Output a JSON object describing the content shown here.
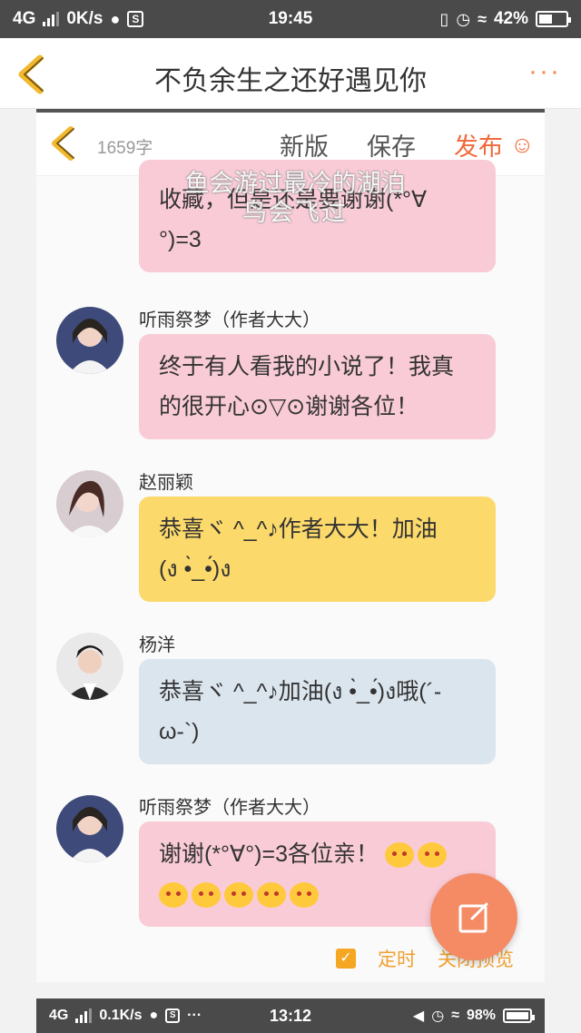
{
  "status_bar": {
    "network": "4G",
    "speed": "0K/s",
    "time": "19:45",
    "battery": "42%"
  },
  "header": {
    "title": "不负余生之还好遇见你"
  },
  "editor": {
    "word_count": "1659字",
    "new_version": "新版",
    "save": "保存",
    "publish": "发布",
    "publish_glyph": "◡̈"
  },
  "overlay": {
    "line1": "鱼会游过最冷的湖泊",
    "line2": "鸟会飞过"
  },
  "messages": [
    {
      "name": "",
      "lines": [
        "收藏，但是还是要谢谢(*°∀",
        "°)=3"
      ]
    },
    {
      "name": "听雨祭梦（作者大大）",
      "lines": [
        "终于有人看我的小说了！我真",
        "的很开心⊙▽⊙谢谢各位！"
      ]
    },
    {
      "name": "赵丽颖",
      "lines": [
        "恭喜ヾ ^_^♪作者大大！加油",
        "(ง •̀_•́)ง"
      ]
    },
    {
      "name": "杨洋",
      "lines": [
        "恭喜ヾ ^_^♪加油(ง •̀_•́)ง哦(´-",
        "ω-`)"
      ]
    },
    {
      "name": "听雨祭梦（作者大大）",
      "lines": [
        "谢谢(*°∀°)=3各位亲！"
      ]
    }
  ],
  "options": {
    "timed": "定时",
    "preview": "关闭预览"
  },
  "status_bar2": {
    "network": "4G",
    "speed": "0.1K/s",
    "time": "13:12",
    "battery": "98%"
  }
}
